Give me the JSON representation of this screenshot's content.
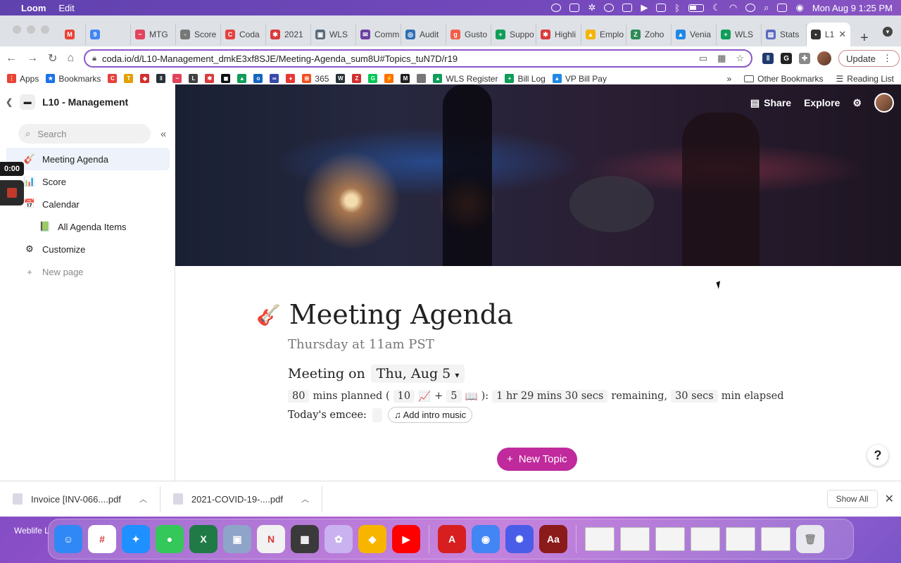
{
  "menubar": {
    "app_name": "Loom",
    "menu_edit": "Edit",
    "datetime": "Mon Aug 9  1:25 PM"
  },
  "browser": {
    "tabs": [
      {
        "label": "",
        "color": "#ea4335",
        "glyph": "M"
      },
      {
        "label": "",
        "color": "#4285f4",
        "glyph": "9"
      },
      {
        "label": "MTG",
        "color": "#e2445c",
        "glyph": "~"
      },
      {
        "label": "Score",
        "color": "#777777",
        "glyph": "▫"
      },
      {
        "label": "Coda",
        "color": "#e5413e",
        "glyph": "C"
      },
      {
        "label": "2021",
        "color": "#d83b3b",
        "glyph": "✱"
      },
      {
        "label": "WLS",
        "color": "#5a6b7b",
        "glyph": "▣"
      },
      {
        "label": "Comm",
        "color": "#6b3fa0",
        "glyph": "✉"
      },
      {
        "label": "Audit",
        "color": "#2f6fb3",
        "glyph": "◎"
      },
      {
        "label": "Gusto",
        "color": "#f45d48",
        "glyph": "g"
      },
      {
        "label": "Suppo",
        "color": "#0f9d58",
        "glyph": "+"
      },
      {
        "label": "Highli",
        "color": "#d83b3b",
        "glyph": "✱"
      },
      {
        "label": "Emplo",
        "color": "#f4b400",
        "glyph": "▲"
      },
      {
        "label": "Zoho",
        "color": "#2e8b57",
        "glyph": "Z"
      },
      {
        "label": "Venia",
        "color": "#1e88e5",
        "glyph": "▲"
      },
      {
        "label": "WLS",
        "color": "#0f9d58",
        "glyph": "+"
      },
      {
        "label": "Stats",
        "color": "#5c6bc0",
        "glyph": "▤"
      },
      {
        "label": "L1",
        "color": "#333333",
        "glyph": "▪"
      }
    ],
    "url": "coda.io/d/L10-Management_dmkE3xf8SJE/Meeting-Agenda_sum8U#Topics_tuN7D/r19",
    "update_label": "Update",
    "bookmarks": [
      {
        "label": "Apps",
        "color": "#ea4335",
        "glyph": "⋮"
      },
      {
        "label": "Bookmarks",
        "color": "#1a73e8",
        "glyph": "★"
      },
      {
        "label": "",
        "color": "#e5413e",
        "glyph": "C"
      },
      {
        "label": "",
        "color": "#e1a100",
        "glyph": "T"
      },
      {
        "label": "",
        "color": "#d32f2f",
        "glyph": "◆"
      },
      {
        "label": "",
        "color": "#263238",
        "glyph": "‖"
      },
      {
        "label": "",
        "color": "#e2445c",
        "glyph": "~"
      },
      {
        "label": "",
        "color": "#424242",
        "glyph": "L"
      },
      {
        "label": "",
        "color": "#d83b3b",
        "glyph": "✱"
      },
      {
        "label": "",
        "color": "#111111",
        "glyph": "◼"
      },
      {
        "label": "",
        "color": "#0f9d58",
        "glyph": "▲"
      },
      {
        "label": "",
        "color": "#1565c0",
        "glyph": "o"
      },
      {
        "label": "",
        "color": "#3949ab",
        "glyph": "∞"
      },
      {
        "label": "",
        "color": "#e53935",
        "glyph": "♦"
      },
      {
        "label": "365",
        "color": "#f25022",
        "glyph": "⊞"
      },
      {
        "label": "",
        "color": "#263238",
        "glyph": "W"
      },
      {
        "label": "",
        "color": "#d32f2f",
        "glyph": "Z"
      },
      {
        "label": "",
        "color": "#00c853",
        "glyph": "G"
      },
      {
        "label": "",
        "color": "#ff6f00",
        "glyph": "⚡"
      },
      {
        "label": "",
        "color": "#212121",
        "glyph": "M"
      },
      {
        "label": "",
        "color": "#777777",
        "glyph": ""
      },
      {
        "label": "WLS Register",
        "color": "#0f9d58",
        "glyph": "▲"
      },
      {
        "label": "Bill Log",
        "color": "#0f9d58",
        "glyph": "+"
      },
      {
        "label": "VP Bill Pay",
        "color": "#1e88e5",
        "glyph": "▲"
      }
    ],
    "other_bookmarks": "Other Bookmarks",
    "reading_list": "Reading List",
    "more": "»"
  },
  "sidebar": {
    "doc_title": "L10 - Management",
    "search_placeholder": "Search",
    "loom_timer": "0:00",
    "items": [
      {
        "label": "Meeting Agenda",
        "icon": "🎸",
        "icon_name": "guitar-icon"
      },
      {
        "label": "Score",
        "icon": "📊",
        "icon_name": "score-icon"
      },
      {
        "label": "Calendar",
        "icon": "📅",
        "icon_name": "calendar-icon"
      },
      {
        "label": "All Agenda Items",
        "icon": "📗",
        "icon_name": "book-icon"
      },
      {
        "label": "Customize",
        "icon": "⚙",
        "icon_name": "gear-icon"
      },
      {
        "label": "New page",
        "icon": "+",
        "icon_name": "plus-icon"
      }
    ]
  },
  "hero": {
    "share": "Share",
    "explore": "Explore"
  },
  "page": {
    "title": "Meeting Agenda",
    "subtitle": "Thursday at 11am PST",
    "meeting_on": "Meeting on",
    "meeting_date": "Thu, Aug 5",
    "mins_planned_value": "80",
    "mins_planned_label": "mins planned (",
    "count_a": "10",
    "plus": "+",
    "count_b": "5",
    "paren_close": "):",
    "remaining_value": "1 hr 29 mins 30 secs",
    "remaining_label": "remaining,",
    "elapsed_value": "30 secs",
    "elapsed_label": "min elapsed",
    "emcee_label": "Today's emcee:",
    "intro_music": "Add intro music",
    "new_topic": "New Topic",
    "help": "?"
  },
  "downloads": {
    "files": [
      {
        "name": "Invoice [INV-066....pdf"
      },
      {
        "name": "2021-COVID-19-....pdf"
      }
    ],
    "show_all": "Show All"
  },
  "dock": {
    "label": "Weblife L",
    "apps": [
      {
        "name": "Finder",
        "color": "#2f88f5",
        "glyph": "☺"
      },
      {
        "name": "Slack",
        "color": "#ffffff",
        "glyph": "#"
      },
      {
        "name": "Safari",
        "color": "#1e90ff",
        "glyph": "✦"
      },
      {
        "name": "Messages",
        "color": "#34c759",
        "glyph": "●"
      },
      {
        "name": "Excel",
        "color": "#1f7a45",
        "glyph": "X"
      },
      {
        "name": "Preview",
        "color": "#8ea4c8",
        "glyph": "▣"
      },
      {
        "name": "News",
        "color": "#f2f2f2",
        "glyph": "N"
      },
      {
        "name": "Calculator",
        "color": "#3a3a3a",
        "glyph": "▦"
      },
      {
        "name": "Looks",
        "color": "#c9b2ef",
        "glyph": "✿"
      },
      {
        "name": "Sketch",
        "color": "#f7b500",
        "glyph": "◆"
      },
      {
        "name": "YouTube",
        "color": "#ff0000",
        "glyph": "▶"
      },
      {
        "name": "Acrobat",
        "color": "#d71f1f",
        "glyph": "A"
      },
      {
        "name": "Chrome",
        "color": "#4285f4",
        "glyph": "◉"
      },
      {
        "name": "Pinwheel",
        "color": "#4a5de8",
        "glyph": "✺"
      },
      {
        "name": "Dictionary",
        "color": "#8b1a1a",
        "glyph": "Aa"
      }
    ]
  }
}
